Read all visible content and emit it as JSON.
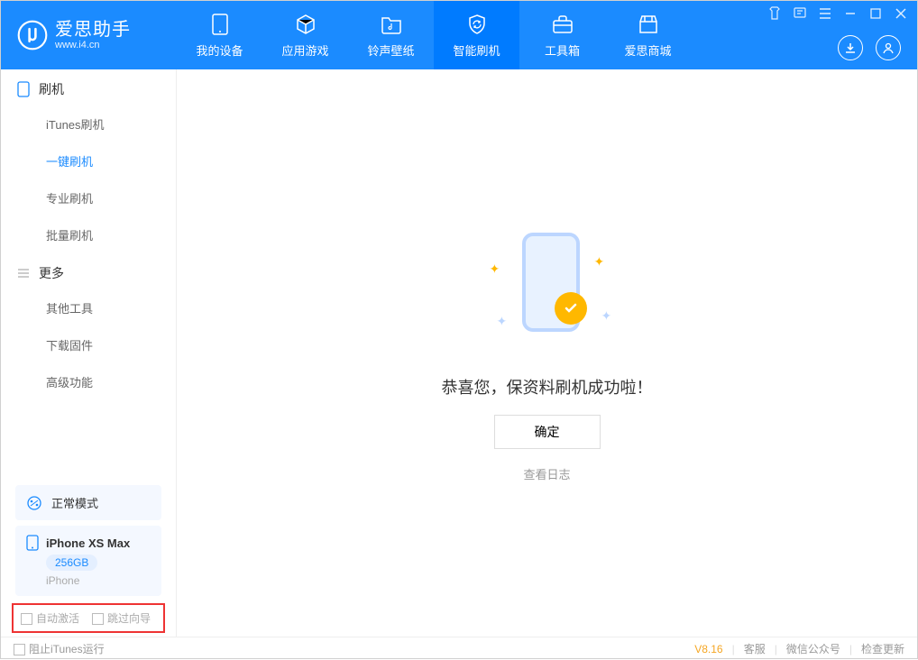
{
  "logo": {
    "title": "爱思助手",
    "sub": "www.i4.cn"
  },
  "tabs": {
    "device": "我的设备",
    "apps": "应用游戏",
    "ringtone": "铃声壁纸",
    "flash": "智能刷机",
    "toolbox": "工具箱",
    "store": "爱思商城"
  },
  "sidebar": {
    "section1_title": "刷机",
    "items1": {
      "itunes": "iTunes刷机",
      "onekey": "一键刷机",
      "pro": "专业刷机",
      "batch": "批量刷机"
    },
    "section2_title": "更多",
    "items2": {
      "other": "其他工具",
      "firmware": "下载固件",
      "advanced": "高级功能"
    }
  },
  "mode": {
    "label": "正常模式"
  },
  "device": {
    "name": "iPhone XS Max",
    "storage": "256GB",
    "type": "iPhone"
  },
  "checkboxes": {
    "auto_activate": "自动激活",
    "skip_guide": "跳过向导"
  },
  "main": {
    "success": "恭喜您，保资料刷机成功啦！",
    "ok": "确定",
    "view_log": "查看日志"
  },
  "statusbar": {
    "block_itunes": "阻止iTunes运行",
    "version": "V8.16",
    "support": "客服",
    "wechat": "微信公众号",
    "update": "检查更新"
  }
}
